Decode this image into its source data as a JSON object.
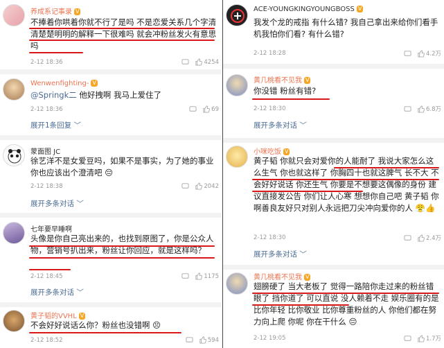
{
  "left": {
    "c1": {
      "name": "养成系记事录",
      "text": "不捧着你哄着你就不行了是吗 不是恋爱关系几个字清清楚楚明明的解释一下很难吗 就会冲粉丝发火有意思吗",
      "time": "2-12 18:36",
      "likes": "4254"
    },
    "c2": {
      "name": "Wenwenfighting-",
      "mention": "@Springk二",
      "text": " 他好拽啊 我马上爱住了",
      "time": "2-12 18:36",
      "likes": "69",
      "expand": "展开1条回复 ﹀"
    },
    "c3": {
      "name": "蒙面图 JC",
      "text": "徐艺洋不是女爱豆吗，如果不是事实，为了她的事业你也应该出个澄清吧 😔",
      "time": "2-12 18:38",
      "likes": "2042",
      "expand": "展开多条对话 ﹀"
    },
    "c4": {
      "name": "七年要早睡啊",
      "text": "头像是你自己亮出来的，也找到原图了，你是公众人物，营销号扒出来，粉丝让你回应，就是这样吗？",
      "time": "2-12 18:45",
      "likes": "1175",
      "expand": "展开多条对话 ﹀"
    },
    "c5": {
      "name": "黄子韬的VVHL",
      "text": "不会好好说话么你？粉丝也没错啊 😣",
      "time": "2-12 18:52",
      "likes": "594"
    }
  },
  "right": {
    "c1": {
      "name": "ACE-YOUNGKINGYOUNGBOSS",
      "text": "我发个龙的戒指 有什么错? 我自己拿出来给你们看手机我怕你们看? 有什么错?",
      "time": "2-12 18:28",
      "likes": "4.2万"
    },
    "c2": {
      "name": "黄几桃看不见我",
      "text": "你没错 粉丝有错?",
      "time": "2-12 18:30",
      "likes": "6.8万",
      "expand": "展开多条对话 ﹀"
    },
    "c3": {
      "name": "小咪吃饭",
      "text": "黄子韬 你就只会对爱你的人能耐了 我说大家怎么这么生气 你也就这样了 你胸四十也就这脾气 长不大 不会好好说话 你还生气 你要是不想要这偶像的身份 建议直接发公告 你们让人心寒 想想你自己吧 黄子韬 你啊善良友好只对别人永远把刀尖冲向爱你的人 😤👍",
      "time": "2-12 18:30",
      "likes": "2.4万",
      "expand": "展开多条对话 ﹀"
    },
    "c4": {
      "name": "黄几桃看不见我",
      "text": "翅膀硬了 当大老板了 觉得一路陪你走过来的粉丝错眼了 挡你道了 可以直说 没人赖着不走 娱乐圈有的是比你年轻 比你敬业 比你尊重粉丝的人 你他们都在努力向上爬 你呢 你在干什么 😔",
      "time": "2-12 19:05",
      "likes": "1.7万"
    }
  },
  "colors": {
    "name": "#eb7350",
    "link": "#4a6b94",
    "underline": "#d61818",
    "meta": "#999999"
  }
}
